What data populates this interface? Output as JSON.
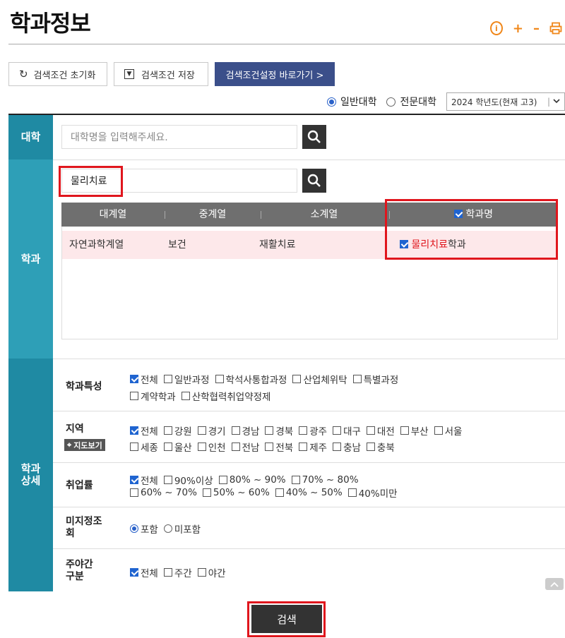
{
  "page": {
    "title": "학과정보"
  },
  "toolbar": {
    "reset_label": "검색조건 초기화",
    "save_label": "검색조건 저장",
    "goto_label": "검색조건설정 바로가기 >"
  },
  "header_icons": [
    "info-icon",
    "plus-icon",
    "minus-icon",
    "print-icon"
  ],
  "school_type": {
    "options": [
      {
        "label": "일반대학",
        "selected": true
      },
      {
        "label": "전문대학",
        "selected": false
      }
    ],
    "year_select": "2024 학년도(현재 고3)"
  },
  "sections": {
    "univ_label": "대학",
    "dept_label": "학과",
    "detail_label": "학과\n상세"
  },
  "univ_search": {
    "placeholder": "대학명을 입력해주세요."
  },
  "dept_search": {
    "value": "물리치료"
  },
  "grid": {
    "headers": [
      "대계열",
      "중계열",
      "소계열",
      "학과명"
    ],
    "rows": [
      {
        "large": "자연과학계열",
        "middle": "보건",
        "small": "재활치료",
        "name_highlight": "물리치료",
        "name_rest": "학과",
        "checked": true
      }
    ]
  },
  "filters": {
    "characteristics": {
      "label": "학과특성",
      "line1": [
        "전체",
        "일반과정",
        "학석사통합과정",
        "산업체위탁",
        "특별과정"
      ],
      "line2": [
        "계약학과",
        "산학협력취업약정제"
      ]
    },
    "region": {
      "label": "지역",
      "map_button": "지도보기",
      "line1": [
        "전체",
        "강원",
        "경기",
        "경남",
        "경북",
        "광주",
        "대구",
        "대전",
        "부산",
        "서울"
      ],
      "line2": [
        "세종",
        "울산",
        "인천",
        "전남",
        "전북",
        "제주",
        "충남",
        "충북"
      ]
    },
    "employment": {
      "label": "취업률",
      "line1": [
        "전체",
        "90%이상",
        "80% ~ 90%",
        "70% ~ 80%"
      ],
      "line2": [
        "60% ~ 70%",
        "50% ~ 60%",
        "40% ~ 50%",
        "40%미만"
      ]
    },
    "unfilled": {
      "label": "미지정조\n회",
      "options": [
        "포함",
        "미포함"
      ]
    },
    "day_night": {
      "label": "주야간\n구분",
      "options": [
        "전체",
        "주간",
        "야간"
      ]
    }
  },
  "submit_label": "검색"
}
